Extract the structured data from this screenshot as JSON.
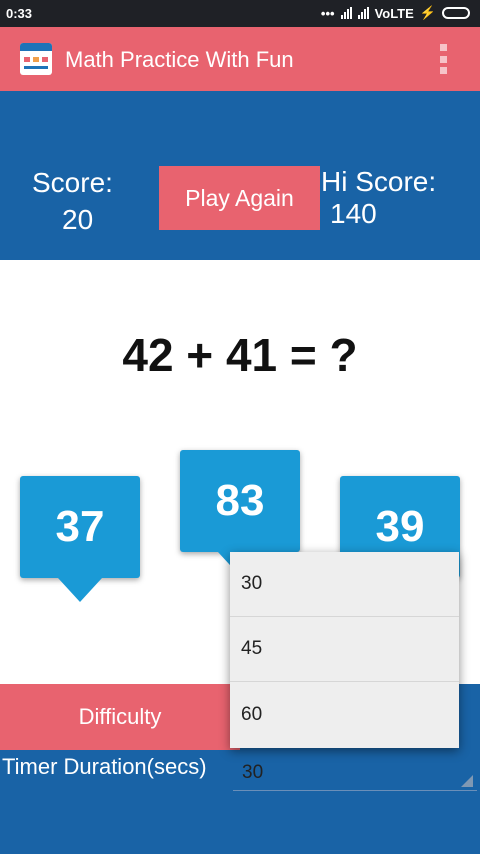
{
  "status_bar": {
    "time": "0:33",
    "network": "VoLTE"
  },
  "app_bar": {
    "title": "Math Practice With Fun"
  },
  "score_panel": {
    "score_label": "Score:",
    "score_value": "20",
    "play_again_label": "Play Again",
    "hiscore_label": "Hi Score:",
    "hiscore_value": "140"
  },
  "question": "42 + 41 = ?",
  "answers": [
    "37",
    "83",
    "39"
  ],
  "settings": {
    "difficulty_label": "Difficulty",
    "timer_label": "Timer Duration(secs)",
    "timer_selected": "30",
    "timer_options": [
      "30",
      "45",
      "60"
    ]
  },
  "colors": {
    "accent": "#e8636f",
    "primary": "#1963a6",
    "bubble": "#1a9ad6"
  }
}
